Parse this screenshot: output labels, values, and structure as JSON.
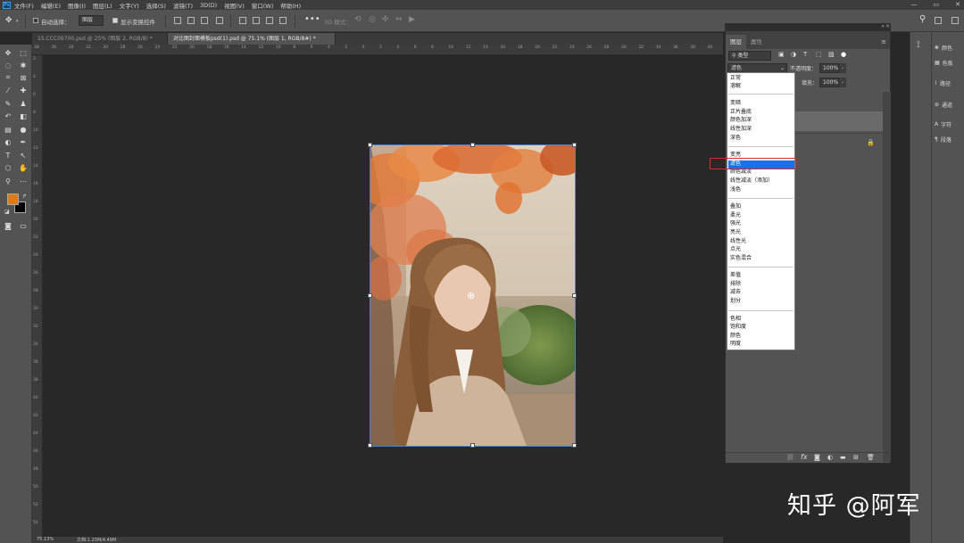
{
  "app": {
    "logo_label": "Ps",
    "menus": [
      "文件(F)",
      "编辑(E)",
      "图像(I)",
      "图层(L)",
      "文字(Y)",
      "选择(S)",
      "滤镜(T)",
      "3D(D)",
      "视图(V)",
      "窗口(W)",
      "帮助(H)"
    ],
    "window_controls": [
      "—",
      "▭",
      "✕"
    ]
  },
  "options_bar": {
    "auto_select_label": "自动选择：",
    "auto_select_value": "图层",
    "show_transform_label": "显示变换控件",
    "mode_3d_label": "3D 模式："
  },
  "tabs": [
    {
      "label": "15.CCC09700.psd @ 25% (图层 2, RGB/8) *",
      "active": false
    },
    {
      "label": "对比图封面模板psd(1).psd @ 75.1% (图层 1, RGB/8#) *",
      "active": true
    }
  ],
  "ruler": {
    "top_labels": [
      "38",
      "36",
      "34",
      "32",
      "30",
      "28",
      "26",
      "24",
      "22",
      "20",
      "18",
      "16",
      "14",
      "12",
      "10",
      "8",
      "6",
      "4",
      "2",
      "0",
      "2",
      "4",
      "6",
      "8",
      "10",
      "12",
      "14",
      "16",
      "18",
      "20",
      "22",
      "24",
      "26",
      "28",
      "30",
      "32",
      "34",
      "36",
      "38",
      "40"
    ],
    "left_labels": [
      "2",
      "4",
      "6",
      "8",
      "10",
      "12",
      "14",
      "16",
      "18",
      "20",
      "22",
      "24",
      "26",
      "28",
      "30",
      "32",
      "34",
      "36",
      "38",
      "40",
      "42",
      "44",
      "46",
      "48",
      "50",
      "52",
      "54"
    ]
  },
  "status": {
    "zoom": "75.13%",
    "doc_info": "文档:1.23M/4.49M"
  },
  "layers_panel": {
    "tabs": [
      "图层",
      "属性"
    ],
    "kind_filter": "类型",
    "blend_mode_current": "滤色",
    "opacity_label": "不透明度：",
    "opacity_value": "100%",
    "fill_label": "填充：",
    "fill_value": "100%",
    "blend_groups": [
      [
        "正常",
        "溶解"
      ],
      [
        "变暗",
        "正片叠底",
        "颜色加深",
        "线性加深",
        "深色"
      ],
      [
        "变亮",
        "滤色",
        "颜色减淡",
        "线性减淡（添加）",
        "浅色"
      ],
      [
        "叠加",
        "柔光",
        "强光",
        "亮光",
        "线性光",
        "点光",
        "实色混合"
      ],
      [
        "差值",
        "排除",
        "减去",
        "划分"
      ],
      [
        "色相",
        "饱和度",
        "颜色",
        "明度"
      ]
    ],
    "selected_mode": "滤色"
  },
  "right_panels": [
    {
      "icon": "color-icon",
      "label": "颜色"
    },
    {
      "icon": "swatches-icon",
      "label": "色板"
    },
    {
      "icon": "paths-icon",
      "label": "路径"
    },
    {
      "icon": "channels-icon",
      "label": "通道"
    },
    {
      "icon": "character-icon",
      "label": "字符"
    },
    {
      "icon": "paragraph-icon",
      "label": "段落"
    }
  ],
  "watermark": "知乎 @阿军",
  "colors": {
    "foreground": "#e07a12",
    "background": "#000000",
    "selection": "#1473e6",
    "highlight_box": "#e0262a"
  }
}
